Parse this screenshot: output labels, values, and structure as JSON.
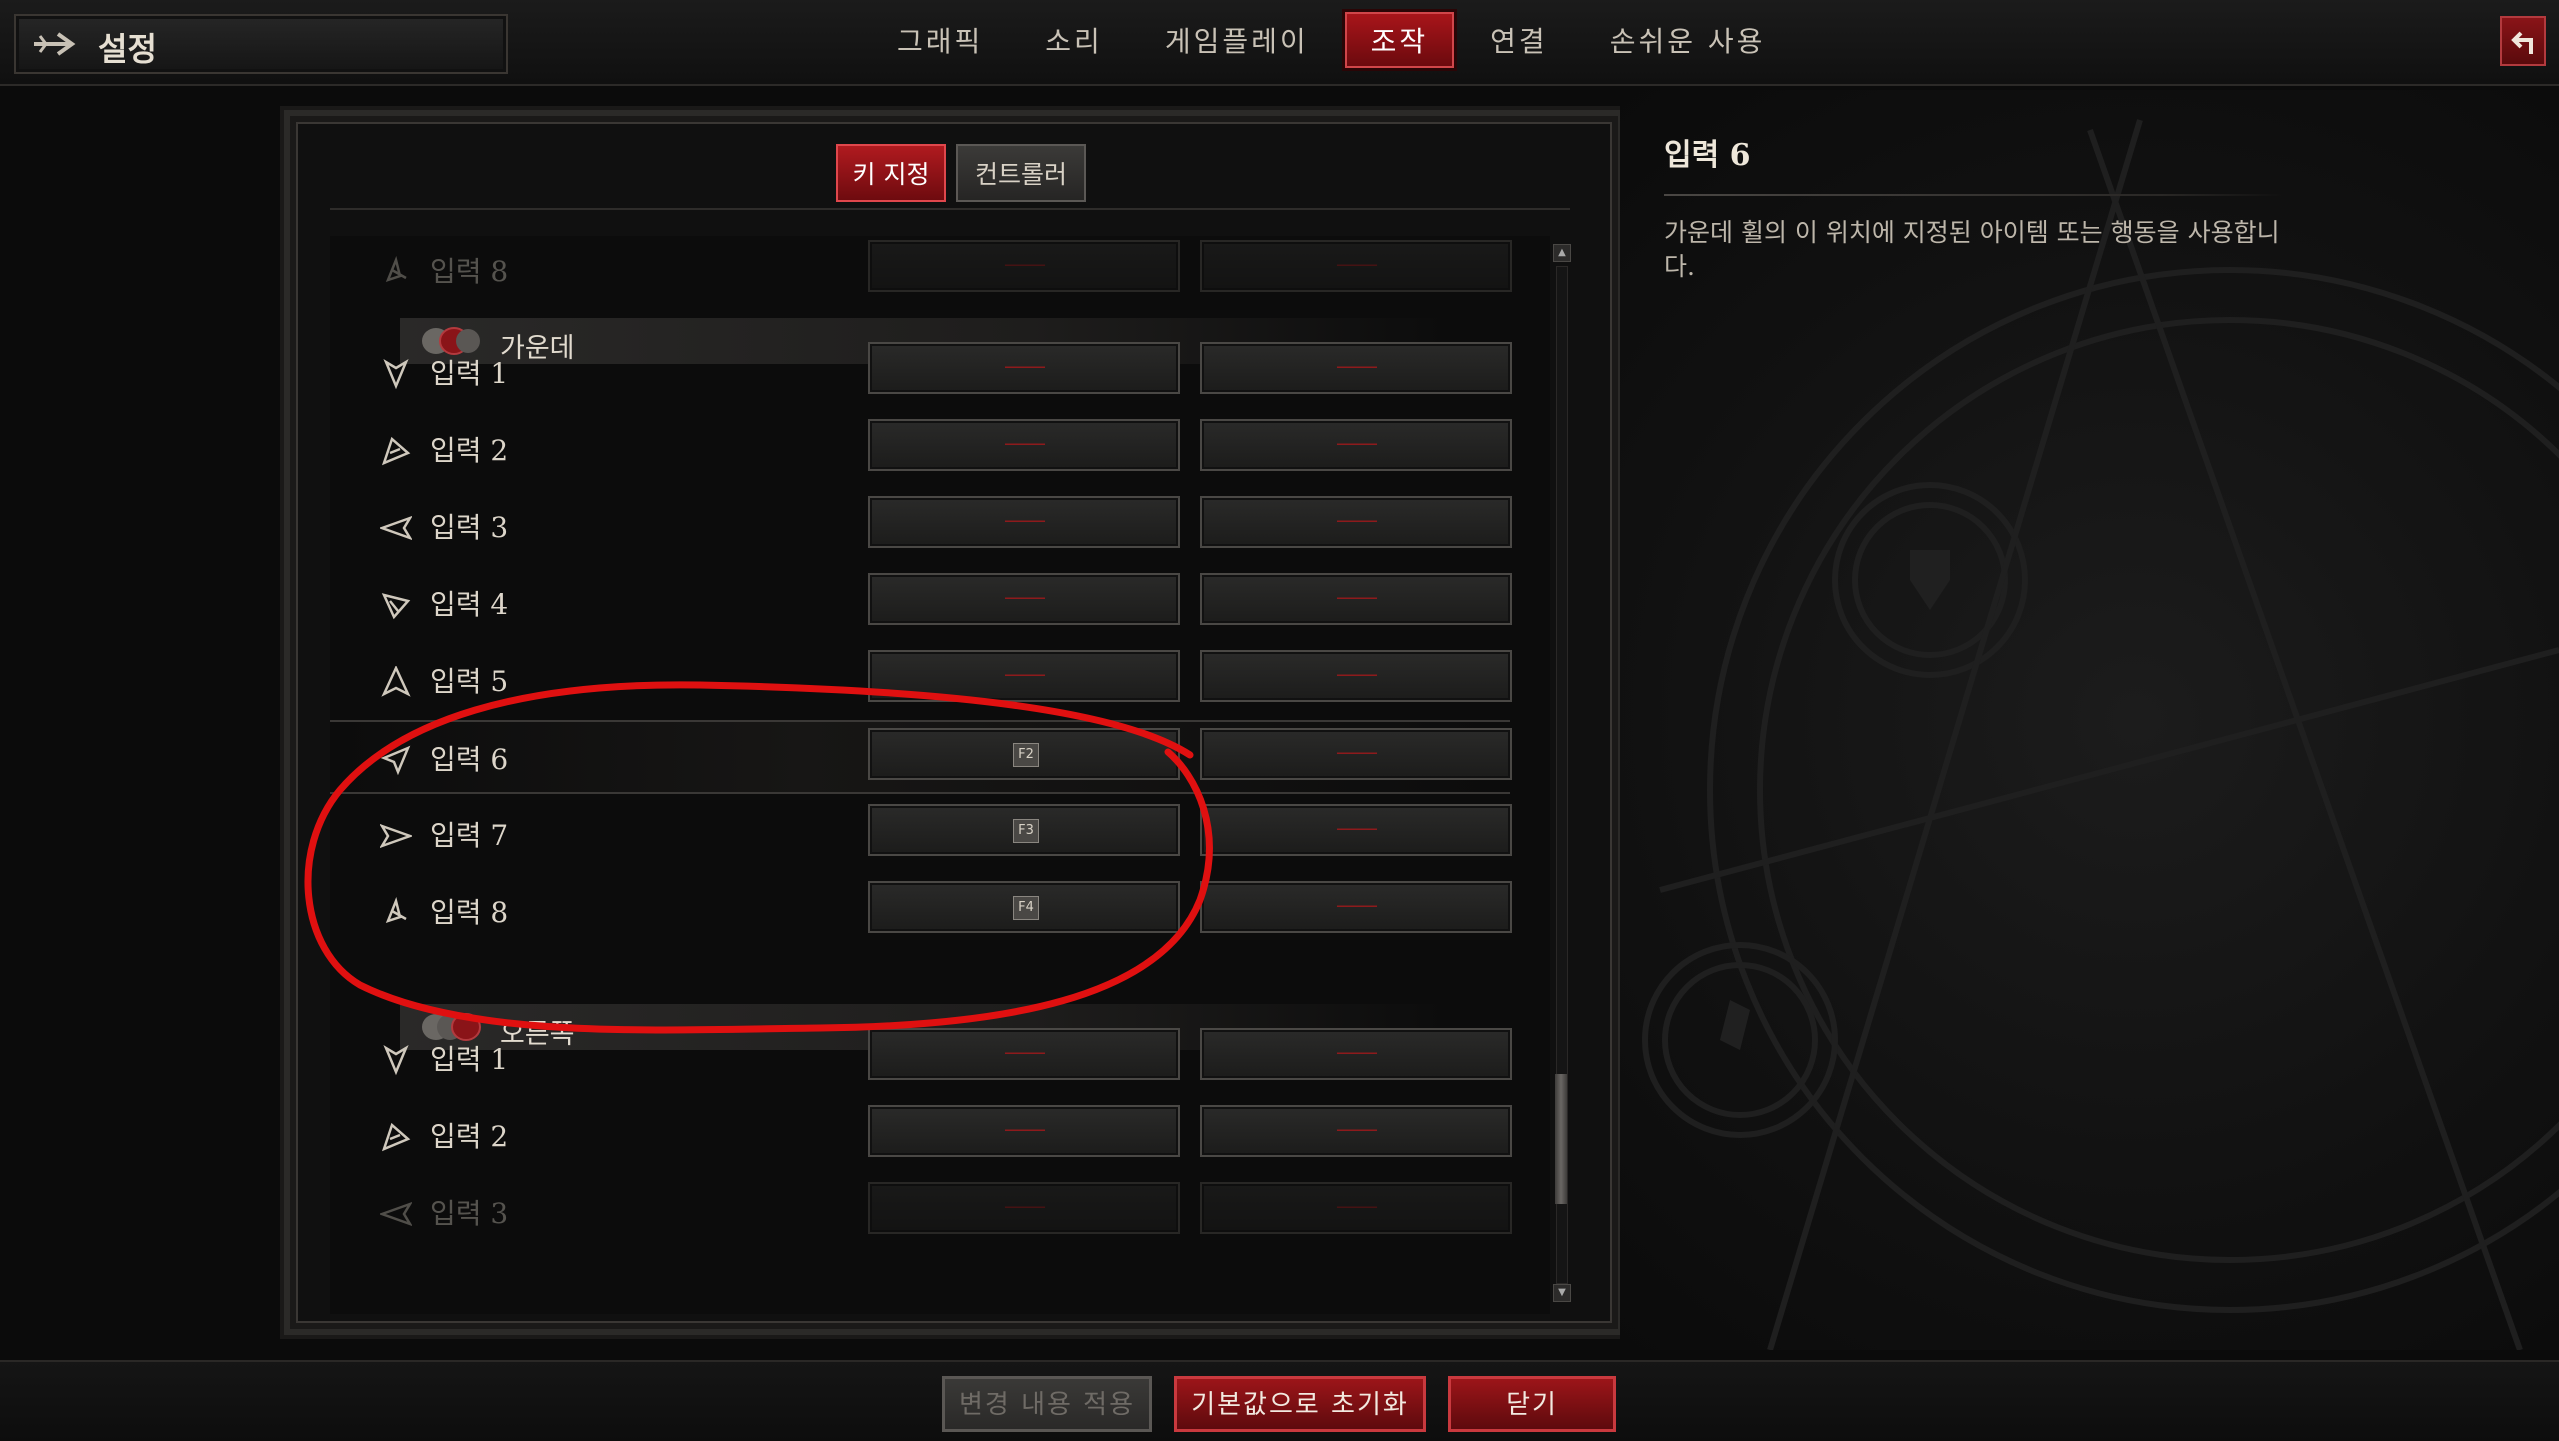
{
  "header": {
    "title": "설정",
    "tabs": [
      {
        "label": "그래픽"
      },
      {
        "label": "소리"
      },
      {
        "label": "게임플레이"
      },
      {
        "label": "조작",
        "active": true
      },
      {
        "label": "연결"
      },
      {
        "label": "손쉬운 사용"
      }
    ]
  },
  "subtabs": [
    {
      "label": "키 지정",
      "active": true
    },
    {
      "label": "컨트롤러"
    }
  ],
  "list": {
    "top_partial": {
      "label": "입력 8"
    },
    "middle_section": {
      "label": "가운데",
      "rows": [
        {
          "label": "입력 1",
          "key1": "",
          "key2": ""
        },
        {
          "label": "입력 2",
          "key1": "",
          "key2": ""
        },
        {
          "label": "입력 3",
          "key1": "",
          "key2": ""
        },
        {
          "label": "입력 4",
          "key1": "",
          "key2": ""
        },
        {
          "label": "입력 5",
          "key1": "",
          "key2": ""
        },
        {
          "label": "입력 6",
          "key1": "F2",
          "key2": ""
        },
        {
          "label": "입력 7",
          "key1": "F3",
          "key2": ""
        },
        {
          "label": "입력 8",
          "key1": "F4",
          "key2": ""
        }
      ]
    },
    "right_section": {
      "label": "오른쪽",
      "rows": [
        {
          "label": "입력 1",
          "key1": "",
          "key2": ""
        },
        {
          "label": "입력 2",
          "key1": "",
          "key2": ""
        },
        {
          "label": "입력 3",
          "key1": "",
          "key2": ""
        }
      ]
    },
    "unbound_marker": "——",
    "selected_row": "입력 6"
  },
  "info": {
    "title": "입력 6",
    "description": "가운데 휠의 이 위치에 지정된 아이템 또는 행동을 사용합니다."
  },
  "footer": {
    "apply_label": "변경 내용 적용",
    "reset_label": "기본값으로 초기화",
    "close_label": "닫기"
  },
  "colors": {
    "accent_red": "#a8151a",
    "annotation_red": "#e01010",
    "background": "#0b0b0b"
  }
}
